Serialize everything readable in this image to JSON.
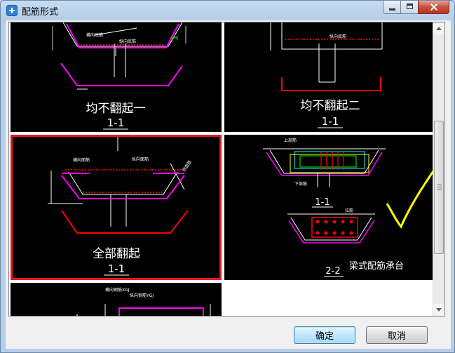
{
  "window": {
    "title": "配筋形式",
    "icon": "app-icon"
  },
  "gallery": {
    "items": [
      {
        "caption": "均不翻起一",
        "section": "1-1",
        "labels": {
          "transverse": "横向底筋",
          "longitudinal": "纵向底筋",
          "side": "CMJ"
        },
        "selected": false
      },
      {
        "caption": "均不翻起二",
        "section": "1-1",
        "labels": {
          "longitudinal": "纵向底筋"
        },
        "selected": false
      },
      {
        "caption": "全部翻起",
        "section": "1-1",
        "labels": {
          "transverse": "横向面筋",
          "longitudinal": "纵向面筋",
          "side": "侧面筋"
        },
        "selected": true
      },
      {
        "caption": "梁式配筋承台",
        "section": "2-2",
        "upper_section": "1-1",
        "labels": {
          "top_bar": "上部筋",
          "bottom_bar": "下部筋",
          "stirrup": "拉筋"
        },
        "selected": false
      },
      {
        "caption": "",
        "section": "",
        "labels": {
          "transverse": "横向钢筋XGJ",
          "longitudinal": "纵向钢筋YGJ"
        },
        "selected": false
      }
    ]
  },
  "buttons": {
    "ok": "确定",
    "cancel": "取消"
  },
  "colors": {
    "selection_border": "#e8191c",
    "rebar_magenta": "#ff00ff",
    "outline_red": "#ff0000",
    "checkmark_yellow": "#ffff00"
  }
}
